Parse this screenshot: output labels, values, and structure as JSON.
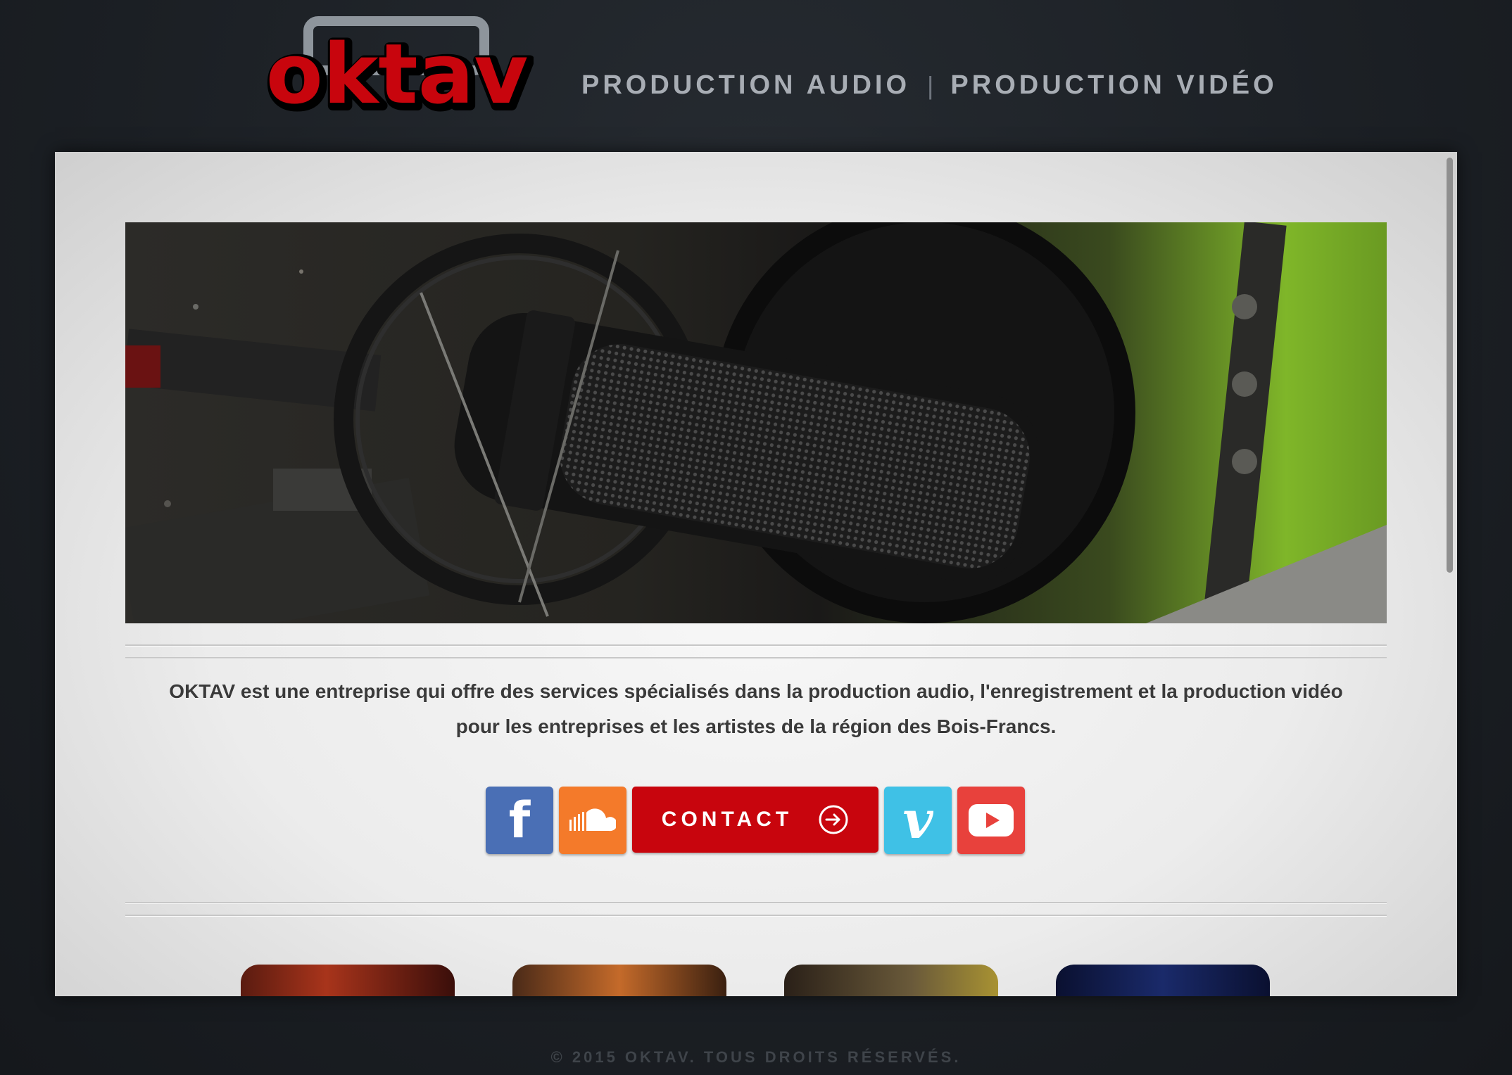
{
  "brand": {
    "logo_text": "oktav",
    "logo_color": "#c8050d"
  },
  "nav": [
    {
      "label": "PRODUCTION AUDIO"
    },
    {
      "label": "PRODUCTION VIDÉO"
    }
  ],
  "nav_separator": "|",
  "hero": {
    "icon": "microphone-image"
  },
  "intro": {
    "line1": "OKTAV est une entreprise qui offre des services spécialisés dans la production audio, l'enregistrement et la production vidéo",
    "line2": "pour les entreprises et les artistes de la région des Bois-Francs."
  },
  "social": {
    "facebook": {
      "glyph": "f",
      "color": "#4a6fb5"
    },
    "soundcloud": {
      "color": "#f47a2a"
    },
    "contact": {
      "label": "CONTACT",
      "color": "#c8050d"
    },
    "vimeo": {
      "glyph": "v",
      "color": "#3fc1e6"
    },
    "youtube": {
      "color": "#e8413c"
    }
  },
  "footer": {
    "text": "© 2015 OKTAV. TOUS DROITS RÉSERVÉS."
  }
}
